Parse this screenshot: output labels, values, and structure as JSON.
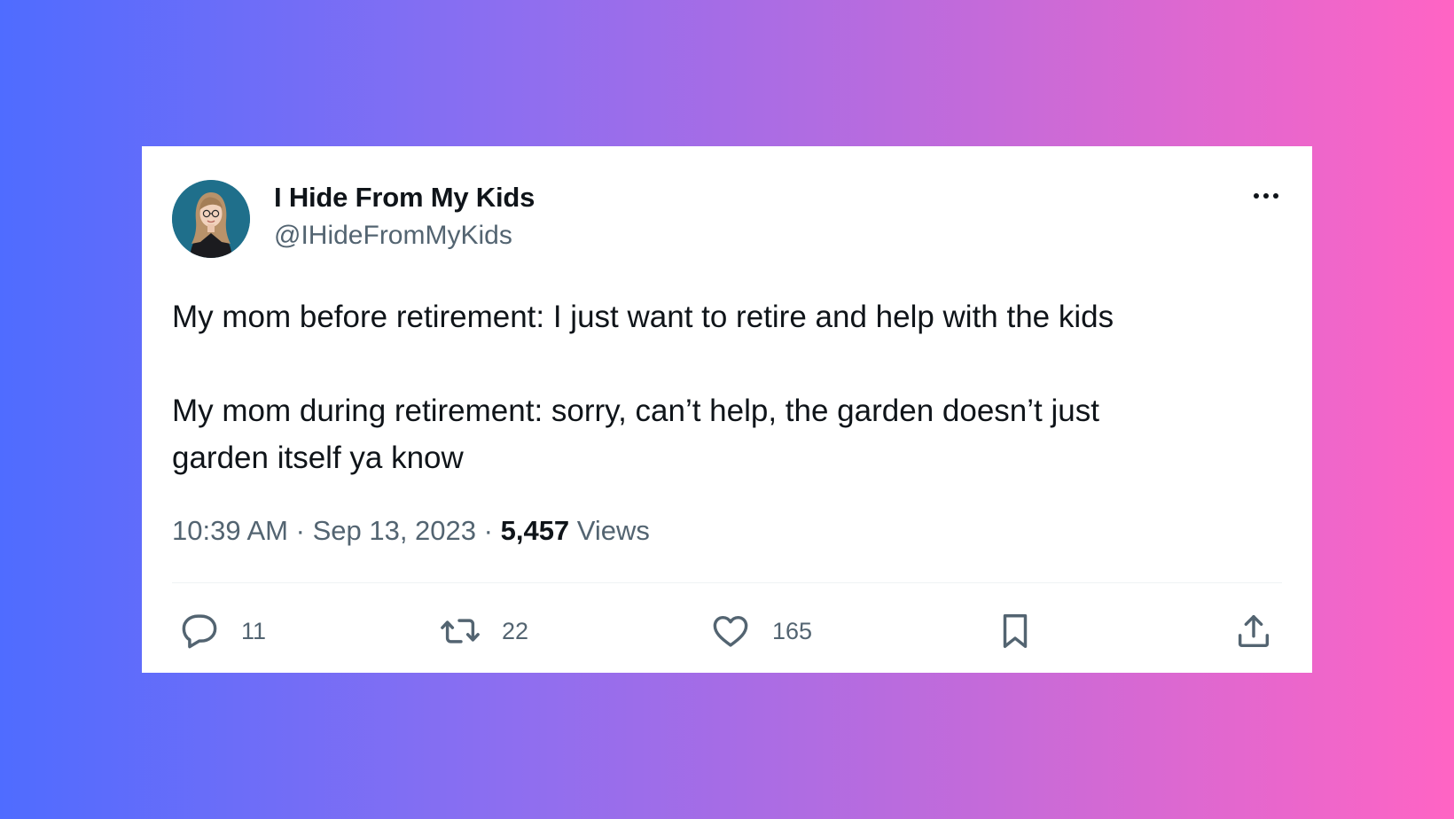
{
  "tweet": {
    "display_name": "I Hide From My Kids",
    "handle": "@IHideFromMyKids",
    "text_lines": [
      "My mom before retirement: I just want to retire and help with the kids",
      "My mom during retirement: sorry, can’t help, the garden doesn’t just",
      "garden itself ya know"
    ],
    "time": "10:39 AM",
    "date": "Sep 13, 2023",
    "separator": "·",
    "views_count": "5,457",
    "views_label": "Views"
  },
  "actions": {
    "replies": "11",
    "retweets": "22",
    "likes": "165"
  },
  "icons": {
    "more": "more-horizontal-icon",
    "reply": "reply-bubble-icon",
    "retweet": "retweet-arrows-icon",
    "like": "heart-icon",
    "bookmark": "bookmark-icon",
    "share": "share-upload-icon"
  },
  "colors": {
    "text_primary": "#0f1419",
    "text_secondary": "#536471",
    "card_background": "#ffffff",
    "gradient_left": "#4f6cff",
    "gradient_right": "#ff64c4"
  }
}
